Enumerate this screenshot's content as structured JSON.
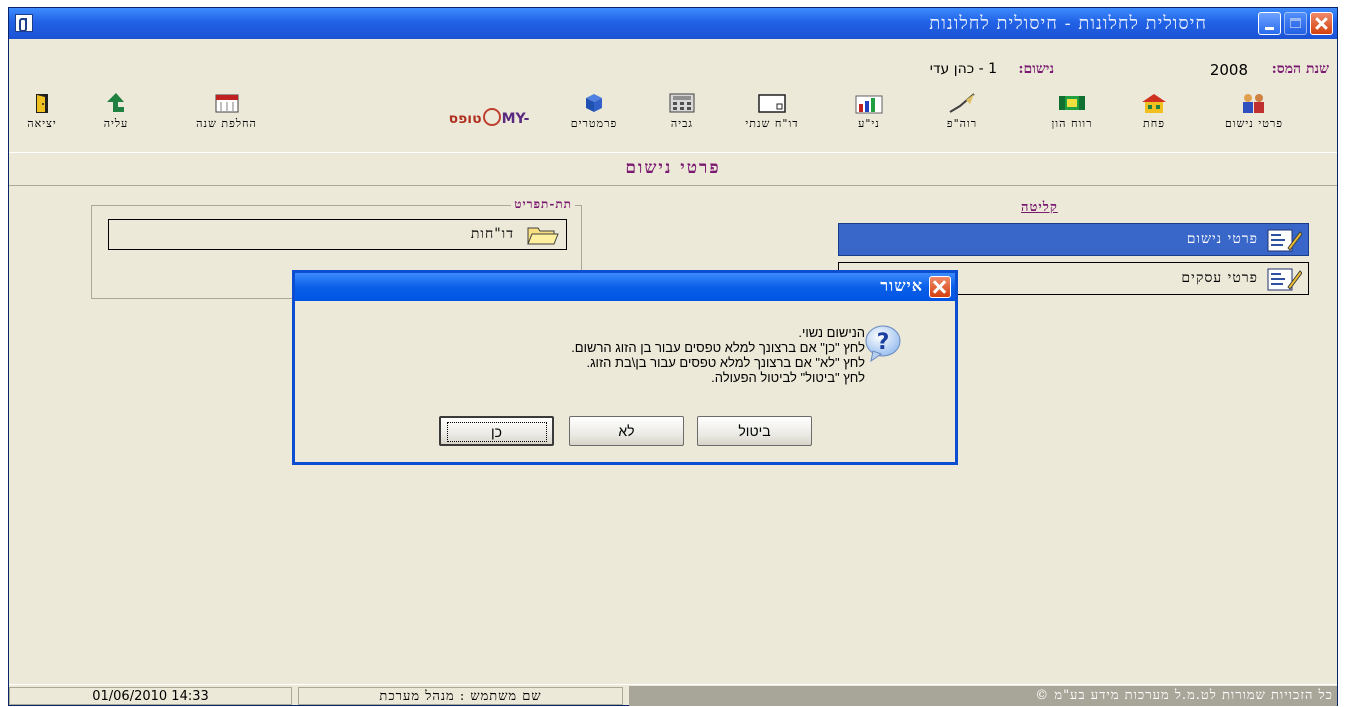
{
  "window": {
    "title": "חיסולית לחלונות - חיסולית לחלונות"
  },
  "info": {
    "tax_year_label": "שנת המס:",
    "tax_year_value": "2008",
    "assessee_label": "נישום:",
    "assessee_value": "1 - כהן עדי"
  },
  "toolbar": {
    "items": [
      {
        "label": "פרטי נישום",
        "icon": "people-icon"
      },
      {
        "label": "פחת",
        "icon": "house-icon"
      },
      {
        "label": "רווח הון",
        "icon": "money-icon"
      },
      {
        "label": "רוה\"פ",
        "icon": "pen-icon"
      },
      {
        "label": "ני\"ע",
        "icon": "chart-icon"
      },
      {
        "label": "דו\"ח שנתי",
        "icon": "report-icon"
      },
      {
        "label": "גביה",
        "icon": "calculator-icon"
      },
      {
        "label": "פרמטרים",
        "icon": "cube-icon"
      },
      {
        "label": "החלפת שנה",
        "icon": "calendar-icon"
      },
      {
        "label": "עליה",
        "icon": "up-arrow-icon"
      },
      {
        "label": "יציאה",
        "icon": "exit-door-icon"
      }
    ],
    "logo_text": "MY-",
    "logo_text_he": "טופס"
  },
  "section": {
    "title": "פרטי נישום"
  },
  "sub_menu": {
    "title": "תת-תפריט",
    "reports_label": "דו\"חות"
  },
  "intake": {
    "title": "קליטה",
    "items": [
      {
        "label": "פרטי נישום",
        "selected": true
      },
      {
        "label": "פרטי עסקים",
        "selected": false
      }
    ]
  },
  "dialog": {
    "title": "אישור",
    "message_lines": [
      "הנישום נשוי.",
      "לחץ \"כן\" אם ברצונך למלא טפסים עבור בן הזוג הרשום.",
      "לחץ \"לא\" אם ברצונך למלא טפסים עבור בן\\בת הזוג.",
      "לחץ \"ביטול\" לביטול הפעולה."
    ],
    "yes_label": "כן",
    "no_label": "לא",
    "cancel_label": "ביטול"
  },
  "status": {
    "datetime": "01/06/2010 14:33",
    "user_label": "שם משתמש : מנהל מערכת",
    "copyright": "כל הזכויות שמורות לט.מ.ל מערכות מידע בע\"מ ©"
  },
  "colors": {
    "accent_title": "#7a1a70",
    "selected_item": "#3867c9",
    "titlebar_blue": "#2162e6"
  }
}
